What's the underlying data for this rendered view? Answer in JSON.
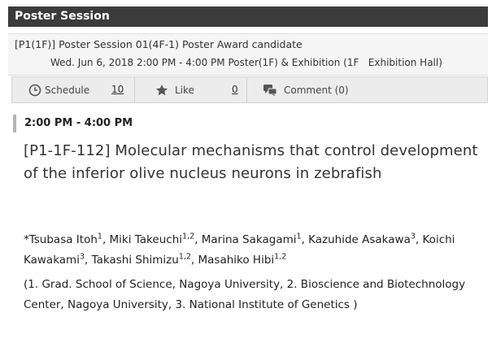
{
  "header": {
    "title": "Poster Session"
  },
  "session": {
    "title": "[P1(1F)] Poster Session 01(4F-1) Poster Award candidate",
    "datetime": "Wed. Jun 6, 2018 2:00 PM - 4:00 PM Poster(1F) & Exhibition (1F   Exhibition Hall)"
  },
  "actions": {
    "schedule_label": "Schedule",
    "schedule_count": "10",
    "like_label": "Like",
    "like_count": "0",
    "comment_label": "Comment (0)"
  },
  "presentation": {
    "time": "2:00 PM - 4:00 PM",
    "title": "[P1-1F-112] Molecular mechanisms that control development of the inferior olive nucleus neurons in zebrafish"
  },
  "authors": [
    {
      "name": "*Tsubasa Itoh",
      "sup": "1",
      "sep": ", "
    },
    {
      "name": "Miki Takeuchi",
      "sup": "1,2",
      "sep": ", "
    },
    {
      "name": "Marina Sakagami",
      "sup": "1",
      "sep": ", "
    },
    {
      "name": "Kazuhide Asakawa",
      "sup": "3",
      "sep": ", "
    },
    {
      "name": "Koichi Kawakami",
      "sup": "3",
      "sep": ", "
    },
    {
      "name": "Takashi Shimizu",
      "sup": "1,2",
      "sep": ", "
    },
    {
      "name": "Masahiko Hibi",
      "sup": "1,2",
      "sep": ""
    }
  ],
  "affiliations": "(1. Grad. School of Science, Nagoya University, 2. Bioscience and Biotechnology Center, Nagoya University, 3. National Institute of Genetics )"
}
